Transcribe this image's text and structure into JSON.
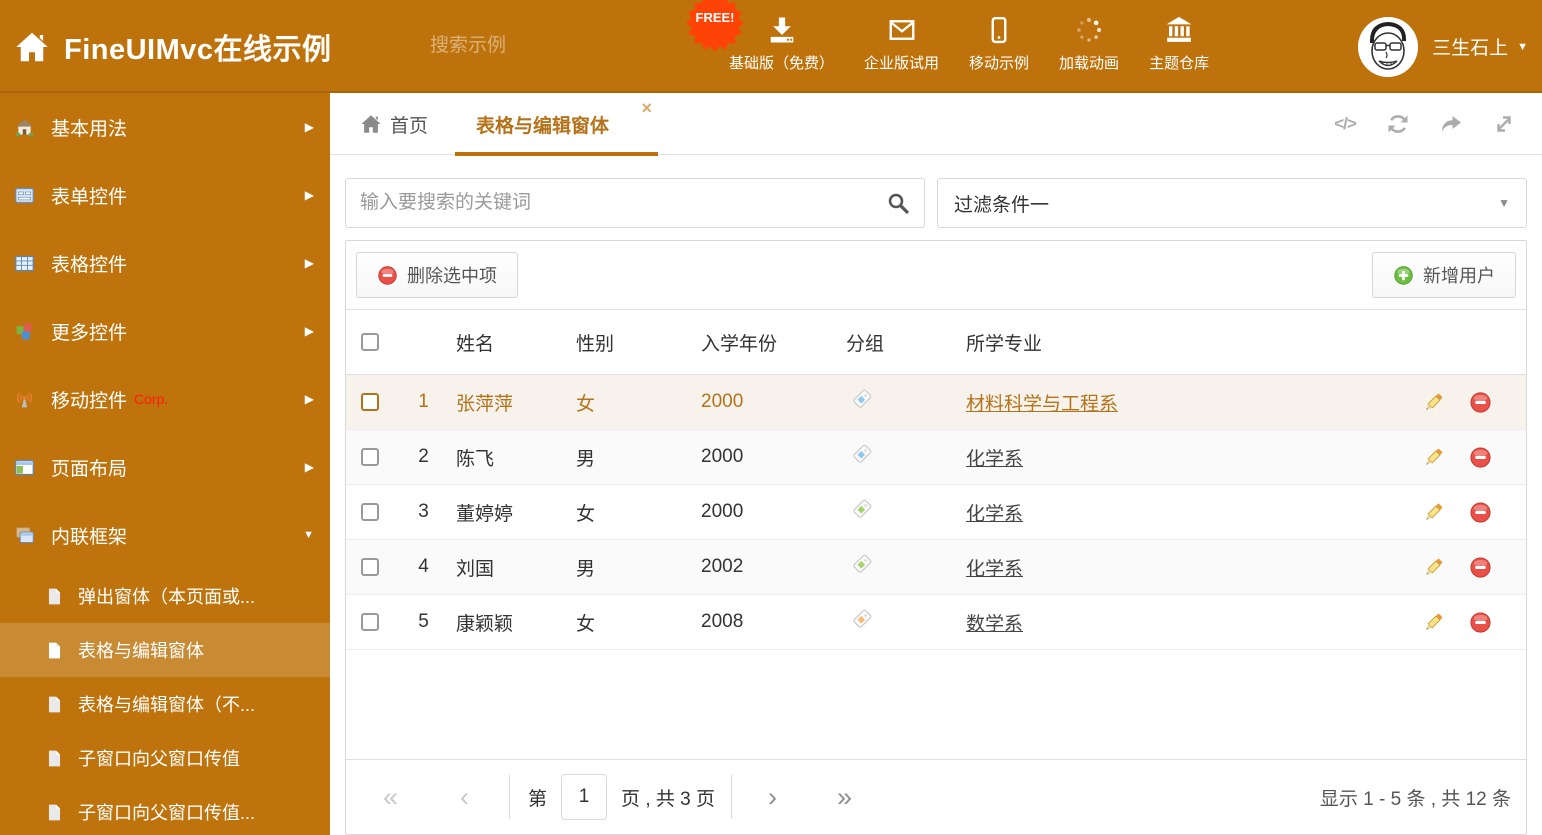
{
  "header": {
    "title": "FineUIMvc在线示例",
    "search_placeholder": "搜索示例",
    "free_badge": "FREE!",
    "nav": [
      {
        "label": "基础版（免费）",
        "icon": "download-icon"
      },
      {
        "label": "企业版试用",
        "icon": "envelope-icon"
      },
      {
        "label": "移动示例",
        "icon": "mobile-icon"
      },
      {
        "label": "加载动画",
        "icon": "spinner-icon"
      },
      {
        "label": "主题仓库",
        "icon": "bank-icon"
      }
    ],
    "username": "三生石上"
  },
  "sidebar": {
    "items": [
      {
        "label": "基本用法",
        "icon": "home-icon"
      },
      {
        "label": "表单控件",
        "icon": "form-icon"
      },
      {
        "label": "表格控件",
        "icon": "table-icon"
      },
      {
        "label": "更多控件",
        "icon": "cubes-icon"
      },
      {
        "label": "移动控件",
        "badge": "Corp.",
        "icon": "antenna-icon"
      },
      {
        "label": "页面布局",
        "icon": "layout-icon"
      },
      {
        "label": "内联框架",
        "icon": "frames-icon"
      }
    ],
    "subitems": [
      {
        "label": "弹出窗体（本页面或..."
      },
      {
        "label": "表格与编辑窗体"
      },
      {
        "label": "表格与编辑窗体（不..."
      },
      {
        "label": "子窗口向父窗口传值"
      },
      {
        "label": "子窗口向父窗口传值..."
      }
    ]
  },
  "tabs": {
    "home": {
      "label": "首页",
      "icon": "home-icon"
    },
    "active": {
      "label": "表格与编辑窗体",
      "close": "×"
    }
  },
  "content": {
    "search_placeholder": "输入要搜索的关键词",
    "filter_value": "过滤条件一",
    "toolbar": {
      "delete_label": "删除选中项",
      "add_label": "新增用户"
    },
    "table": {
      "columns": [
        "姓名",
        "性别",
        "入学年份",
        "分组",
        "所学专业"
      ],
      "rows": [
        {
          "num": "1",
          "name": "张萍萍",
          "gender": "女",
          "year": "2000",
          "tag_color": "#8FC9F2",
          "major": "材料科学与工程系"
        },
        {
          "num": "2",
          "name": "陈飞",
          "gender": "男",
          "year": "2000",
          "tag_color": "#8FC9F2",
          "major": "化学系"
        },
        {
          "num": "3",
          "name": "董婷婷",
          "gender": "女",
          "year": "2000",
          "tag_color": "#A3D46A",
          "major": "化学系"
        },
        {
          "num": "4",
          "name": "刘国",
          "gender": "男",
          "year": "2002",
          "tag_color": "#A3D46A",
          "major": "化学系"
        },
        {
          "num": "5",
          "name": "康颖颖",
          "gender": "女",
          "year": "2008",
          "tag_color": "#FBBB78",
          "major": "数学系"
        }
      ]
    },
    "pagination": {
      "first": "«",
      "prev": "‹",
      "next": "›",
      "last": "»",
      "page_prefix": "第",
      "current_page": "1",
      "page_suffix": "页 , 共 3 页",
      "summary": "显示 1 - 5 条 , 共 12 条"
    }
  },
  "colors": {
    "theme_orange": "#BE720B",
    "active_text": "#B4731B",
    "selected_row_bg": "#F7F3EC",
    "free_badge_red": "#FF4206",
    "corp_red": "#FF1A00"
  }
}
